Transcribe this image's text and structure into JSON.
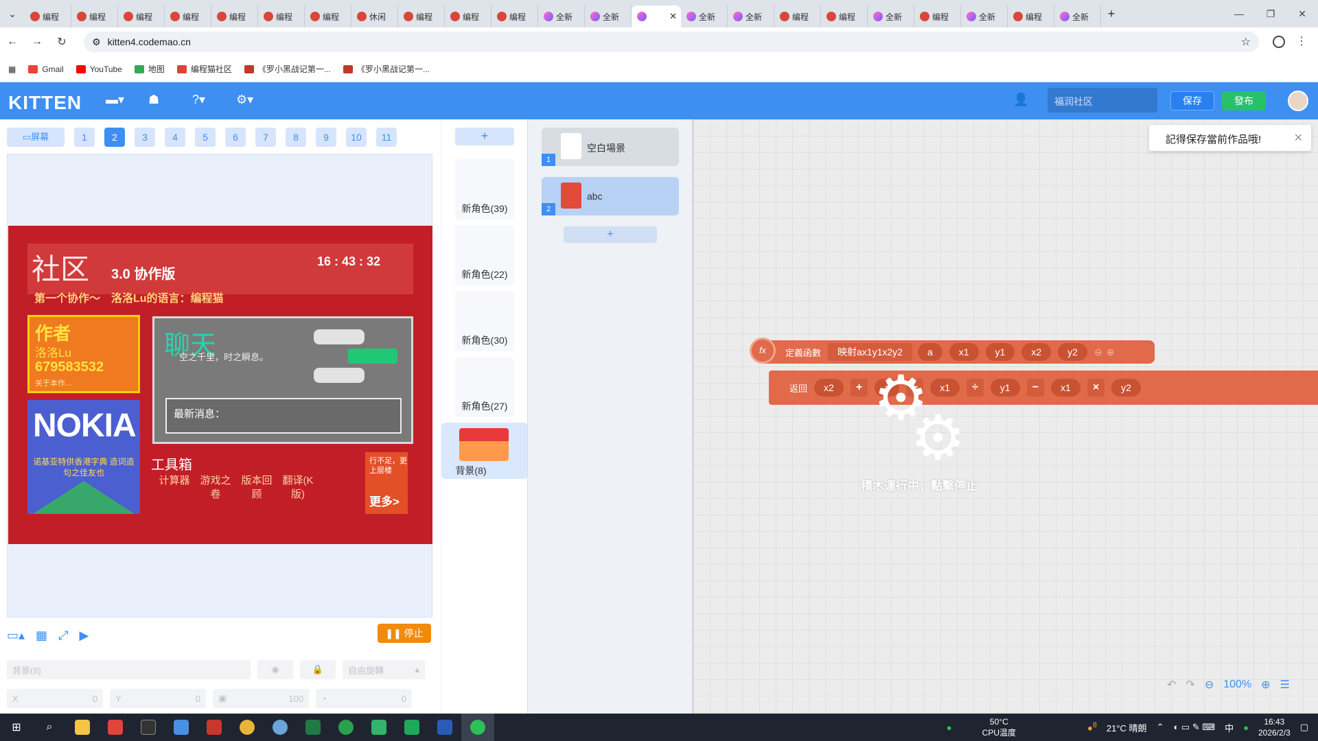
{
  "browser": {
    "tabs": [
      {
        "label": "编程",
        "icon": "codemao-icon"
      },
      {
        "label": "编程",
        "icon": "codemao-icon"
      },
      {
        "label": "编程",
        "icon": "codemao-icon"
      },
      {
        "label": "编程",
        "icon": "codemao-icon"
      },
      {
        "label": "编程",
        "icon": "codemao-icon"
      },
      {
        "label": "编程",
        "icon": "codemao-icon"
      },
      {
        "label": "编程",
        "icon": "codemao-icon"
      },
      {
        "label": "休闲",
        "icon": "codemao-icon"
      },
      {
        "label": "编程",
        "icon": "codemao-icon"
      },
      {
        "label": "编程",
        "icon": "codemao-icon"
      },
      {
        "label": "编程",
        "icon": "codemao-icon"
      },
      {
        "label": "全新",
        "icon": "kitten-icon"
      },
      {
        "label": "全新",
        "icon": "kitten-icon"
      },
      {
        "label": "",
        "icon": "kitten-icon",
        "active": true
      },
      {
        "label": "全新",
        "icon": "kitten-icon"
      },
      {
        "label": "全新",
        "icon": "kitten-icon"
      },
      {
        "label": "编程",
        "icon": "codemao-icon"
      },
      {
        "label": "编程",
        "icon": "codemao-icon"
      },
      {
        "label": "全新",
        "icon": "kitten-icon"
      },
      {
        "label": "编程",
        "icon": "codemao-icon"
      },
      {
        "label": "全新",
        "icon": "kitten-icon"
      },
      {
        "label": "编程",
        "icon": "codemao-icon"
      },
      {
        "label": "全新",
        "icon": "kitten-icon"
      }
    ],
    "url": "kitten4.codemao.cn",
    "bookmarks": [
      "Gmail",
      "YouTube",
      "地图",
      "编程猫社区",
      "《罗小黑战记第一...",
      "《罗小黑战记第一..."
    ]
  },
  "kitten": {
    "logo": "KITTEN",
    "search_placeholder": "福润社区",
    "save": "保存",
    "publish": "發布"
  },
  "stage": {
    "screen_btn": "屏幕",
    "pages": [
      "1",
      "2",
      "3",
      "4",
      "5",
      "6",
      "7",
      "8",
      "9",
      "10",
      "11"
    ],
    "active_page": "2",
    "canvas": {
      "title": "社区",
      "version": "3.0 协作版",
      "clock": "16 : 43 : 32",
      "subtitle": "第一个协作～　洛洛Lu的语言：编程猫",
      "author_title": "作者",
      "author_name": "洛洛Lu",
      "author_id": "679583532",
      "author_note": "关于本作…",
      "nokia_logo": "NOKIA",
      "nokia_caption": "诺基亚特供香港字典 造词造句之佳友也",
      "chat_title": "聊天",
      "chat_quote": "空之千里，时之瞬息。",
      "chat_box_label": "最新消息：",
      "toolbox": "工具箱",
      "tools": [
        "计算器",
        "游戏之卷",
        "版本回顾",
        "翻译(K版)"
      ],
      "more_small": "行不足，更上层楼",
      "more": "更多>"
    },
    "stop_btn": "停止",
    "props": {
      "name_placeholder": "背景(8)",
      "rotate": "自由旋轉",
      "x_label": "X",
      "x_value": "0",
      "y_label": "Y",
      "y_value": "0",
      "size_value": "100",
      "dir_value": "0"
    }
  },
  "sprites": {
    "add": "+",
    "items": [
      "新角色(39)",
      "新角色(22)",
      "新角色(30)",
      "新角色(27)"
    ],
    "selected": "背景(8)"
  },
  "scenes": {
    "items": [
      {
        "num": "1",
        "name": "空白場景"
      },
      {
        "num": "2",
        "name": "abc"
      }
    ],
    "add": "+"
  },
  "workspace": {
    "toast": "記得保存當前作品哦!",
    "define_label": "定義函數",
    "func_name": "映射ax1y1x2y2",
    "params": [
      "a",
      "x1",
      "y1",
      "x2",
      "y2"
    ],
    "return_label": "返回",
    "expr": [
      "x2",
      "+",
      "a",
      "−",
      "x1",
      "÷",
      "y1",
      "−",
      "x1",
      "×",
      "y2"
    ],
    "running": "積木運行中，點擊停止",
    "zoom": "100%"
  },
  "taskbar": {
    "cpu_temp": "50°C",
    "cpu_label": "CPU温度",
    "weather": "21°C 晴朗",
    "weather_badge": "8",
    "ime": "中",
    "time": "16:43",
    "date": "2026/2/3"
  }
}
